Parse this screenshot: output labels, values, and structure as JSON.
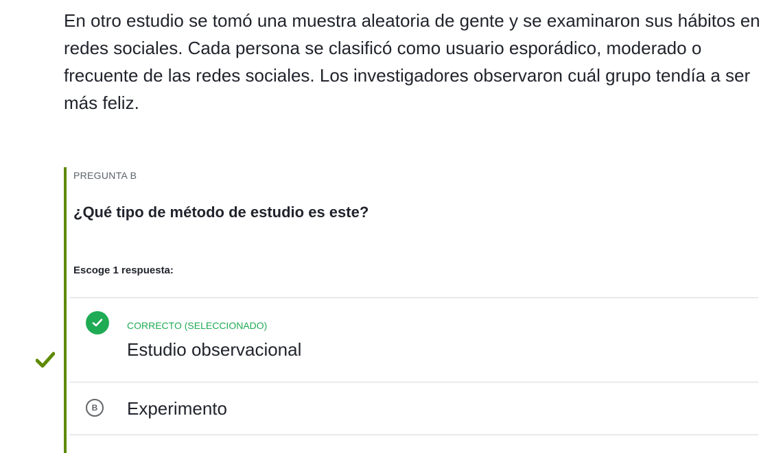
{
  "passage": {
    "text": "En otro estudio se tomó una muestra aleatoria de gente y se examinaron sus hábitos en redes sociales. Cada persona se clasificó como usuario esporádico, moderado o frecuente de las redes sociales. Los investigadores observaron cuál grupo tendía a ser más feliz."
  },
  "question": {
    "label": "PREGUNTA B",
    "text": "¿Qué tipo de método de estudio es este?",
    "instruction": "Escoge 1 respuesta:"
  },
  "choices": [
    {
      "status": "CORRECTO (SELECCIONADO)",
      "text": "Estudio observacional",
      "icon": "check-circle-icon",
      "selected": true
    },
    {
      "letter": "B",
      "text": "Experimento",
      "selected": false
    }
  ],
  "colors": {
    "accent_bar": "#5e8a00",
    "correct": "#1fab54",
    "outside_check": "#5e8a00"
  }
}
